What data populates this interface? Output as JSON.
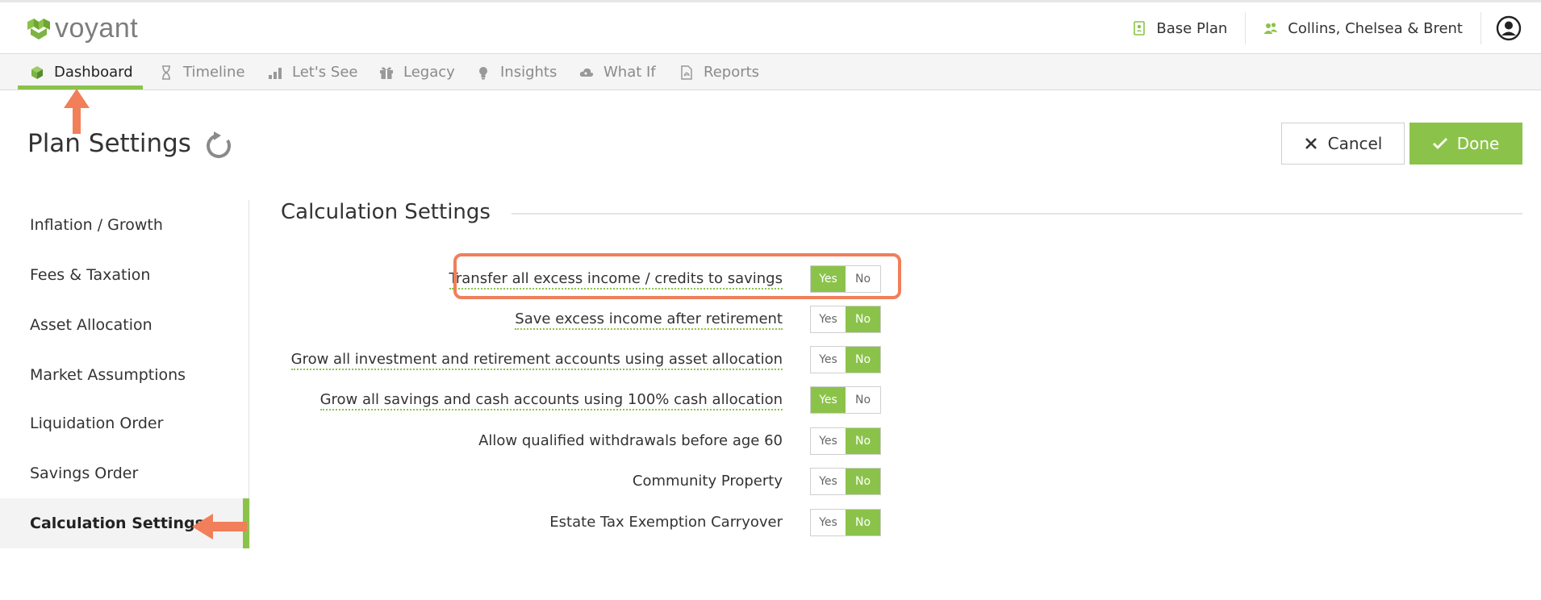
{
  "header": {
    "logo_text": "voyant",
    "plan_label": "Base Plan",
    "client_label": "Collins, Chelsea & Brent",
    "plan_icon": "plan-doc-icon",
    "client_icon": "people-icon",
    "avatar_icon": "user-circle-icon"
  },
  "nav": {
    "items": [
      {
        "label": "Dashboard",
        "icon": "cube-icon",
        "active": true
      },
      {
        "label": "Timeline",
        "icon": "hourglass-icon",
        "active": false
      },
      {
        "label": "Let's See",
        "icon": "bar-chart-icon",
        "active": false
      },
      {
        "label": "Legacy",
        "icon": "gift-icon",
        "active": false
      },
      {
        "label": "Insights",
        "icon": "lightbulb-icon",
        "active": false
      },
      {
        "label": "What If",
        "icon": "cloud-icon",
        "active": false
      },
      {
        "label": "Reports",
        "icon": "pdf-file-icon",
        "active": false
      }
    ]
  },
  "page": {
    "title": "Plan Settings",
    "cancel_label": "Cancel",
    "done_label": "Done"
  },
  "sidebar": {
    "items": [
      {
        "label": "Inflation / Growth",
        "active": false
      },
      {
        "label": "Fees & Taxation",
        "active": false
      },
      {
        "label": "Asset Allocation",
        "active": false
      },
      {
        "label": "Market Assumptions",
        "active": false
      },
      {
        "label": "Liquidation Order",
        "active": false
      },
      {
        "label": "Savings Order",
        "active": false
      },
      {
        "label": "Calculation Settings",
        "active": true
      }
    ]
  },
  "main": {
    "section_title": "Calculation Settings",
    "yes_label": "Yes",
    "no_label": "No",
    "settings": [
      {
        "label": "Transfer all excess income / credits to savings",
        "value": "Yes",
        "dotted": true
      },
      {
        "label": "Save excess income after retirement",
        "value": "No",
        "dotted": true
      },
      {
        "label": "Grow all investment and retirement accounts using asset allocation",
        "value": "No",
        "dotted": true
      },
      {
        "label": "Grow all savings and cash accounts using 100% cash allocation",
        "value": "Yes",
        "dotted": true
      },
      {
        "label": "Allow qualified withdrawals before age 60",
        "value": "No",
        "dotted": false
      },
      {
        "label": "Community Property",
        "value": "No",
        "dotted": false
      },
      {
        "label": "Estate Tax Exemption Carryover",
        "value": "No",
        "dotted": false
      }
    ]
  },
  "colors": {
    "accent": "#8bc34a",
    "annotation": "#f07f5a"
  }
}
